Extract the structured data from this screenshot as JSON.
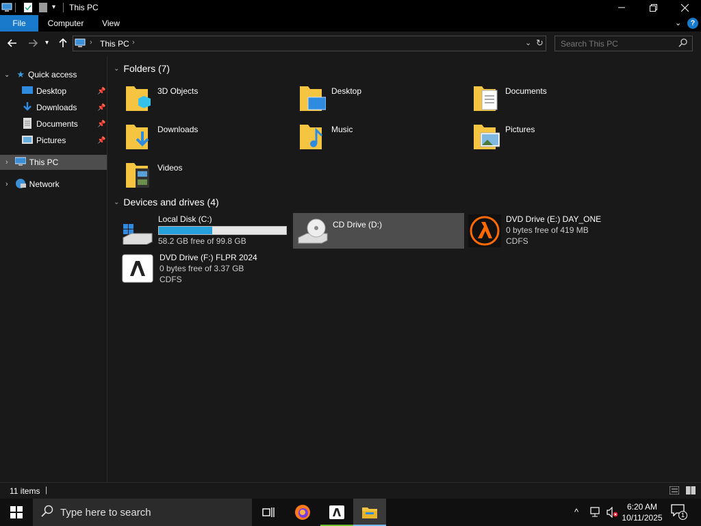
{
  "window": {
    "title": "This PC"
  },
  "ribbon": {
    "tabs": [
      "File",
      "Computer",
      "View"
    ]
  },
  "address": {
    "crumb": "This PC",
    "search_placeholder": "Search This PC"
  },
  "sidebar": {
    "quick_access": "Quick access",
    "items": [
      {
        "label": "Desktop",
        "icon": "desktop-icon",
        "pinned": true
      },
      {
        "label": "Downloads",
        "icon": "downloads-icon",
        "pinned": true
      },
      {
        "label": "Documents",
        "icon": "documents-icon",
        "pinned": true
      },
      {
        "label": "Pictures",
        "icon": "pictures-icon",
        "pinned": true
      }
    ],
    "this_pc": "This PC",
    "network": "Network"
  },
  "folders": {
    "header": "Folders (7)",
    "items": [
      "3D Objects",
      "Desktop",
      "Documents",
      "Downloads",
      "Music",
      "Pictures",
      "Videos"
    ]
  },
  "drives": {
    "header": "Devices and drives (4)",
    "items": [
      {
        "name": "Local Disk (C:)",
        "free": "58.2 GB free of 99.8 GB",
        "used_fraction": 0.42
      },
      {
        "name": "CD Drive (D:)"
      },
      {
        "name": "DVD Drive (E:) DAY_ONE",
        "free": "0 bytes free of 419 MB",
        "fs": "CDFS"
      },
      {
        "name": "DVD Drive (F:) FLPR 2024",
        "free": "0 bytes free of 3.37 GB",
        "fs": "CDFS"
      }
    ]
  },
  "status": {
    "items": "11 items"
  },
  "taskbar": {
    "search_placeholder": "Type here to search",
    "time": "6:20 AM",
    "date": "10/11/2025",
    "notif_count": "1"
  },
  "colors": {
    "accent": "#1979ca",
    "progress": "#26a0da",
    "folder": "#f5c542"
  }
}
